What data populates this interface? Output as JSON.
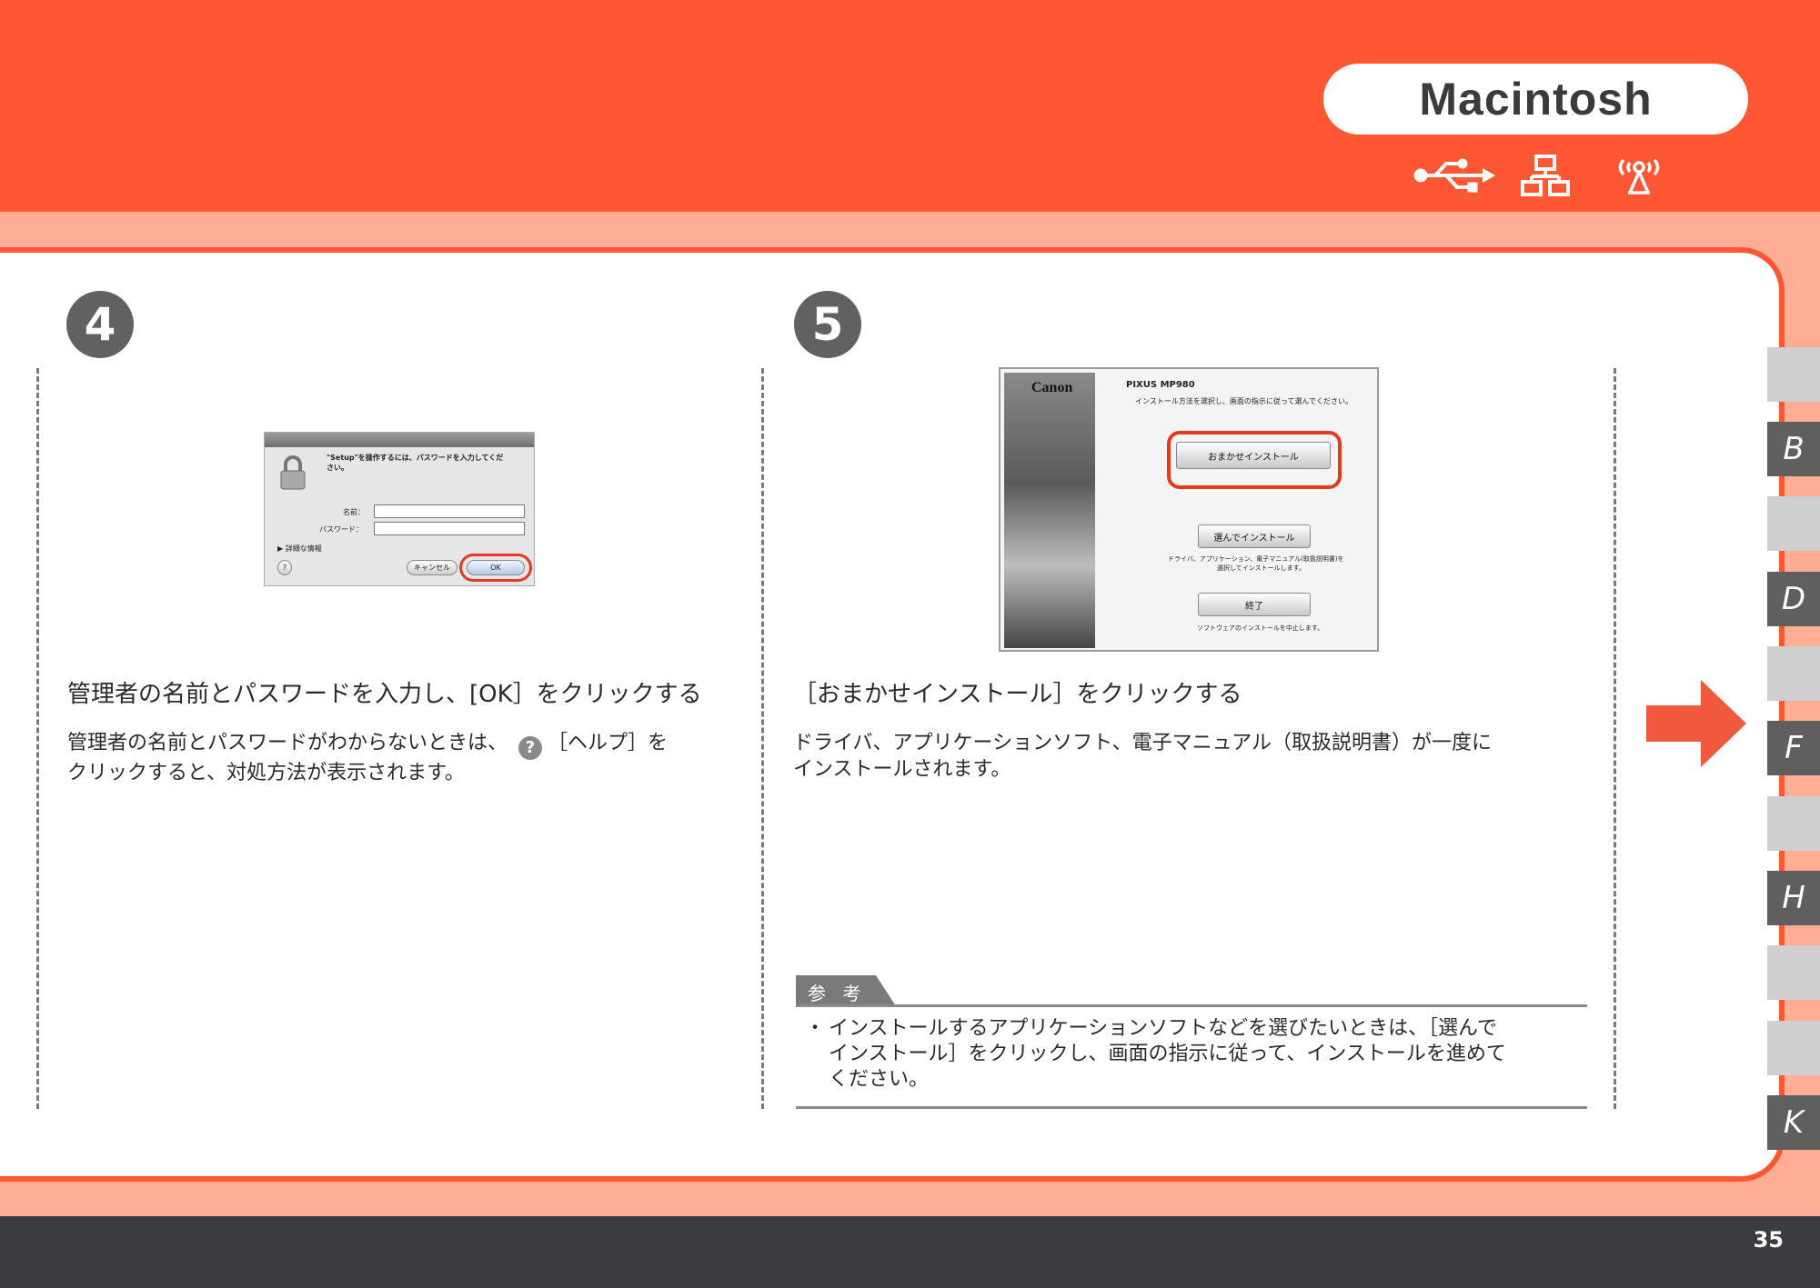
{
  "header": {
    "os_label": "Macintosh",
    "connection_icons": [
      "usb-icon",
      "network-icon",
      "wireless-icon"
    ]
  },
  "steps": [
    {
      "number": "4",
      "heading": "管理者の名前とパスワードを入力し、[OK］をクリックする",
      "body_part1": "管理者の名前とパスワードがわからないときは、",
      "help_glyph": "?",
      "body_part2": "［ヘルプ］を",
      "body_part3": "クリックすると、対処方法が表示されます。",
      "dialog": {
        "message_line1": "\"Setup\"を操作するには、パスワードを入力してくだ",
        "message_line2": "さい。",
        "name_label": "名前：",
        "password_label": "パスワード：",
        "details_label": "▶ 詳細な情報",
        "help_button": "?",
        "cancel_button": "キャンセル",
        "ok_button": "OK"
      }
    },
    {
      "number": "5",
      "heading": "［おまかせインストール］をクリックする",
      "body_line1": "ドライバ、アプリケーションソフト、電子マニュアル（取扱説明書）が一度に",
      "body_line2": "インストールされます。",
      "installer": {
        "brand": "Canon",
        "model": "PIXUS MP980",
        "instruction": "インストール方法を選択し、画面の指示に従って選んでください。",
        "easy_install_button": "おまかせインストール",
        "custom_install_button": "選んでインストール",
        "custom_install_desc_line1": "ドライバ、アプリケーション、電子マニュアル(取扱説明書)を",
        "custom_install_desc_line2": "選択してインストールします。",
        "exit_button": "終了",
        "exit_desc": "ソフトウェアのインストールを中止します。"
      }
    }
  ],
  "note": {
    "tab_label": "参 考",
    "bullet": "・",
    "text_line1": "インストールするアプリケーションソフトなどを選びたいときは、［選んで",
    "text_line2": "インストール］をクリックし、画面の指示に従って、インストールを進めて",
    "text_line3": "ください。"
  },
  "side_tabs": [
    "B",
    "D",
    "F",
    "H",
    "K"
  ],
  "page_number": "35",
  "colors": {
    "accent": "#ff5733",
    "band": "#ffad95",
    "footer": "#3b3c40",
    "tab_gray": "#cfcfcf",
    "tab_dark": "#5f5f5f",
    "highlight_ring": "#e63a1f"
  }
}
